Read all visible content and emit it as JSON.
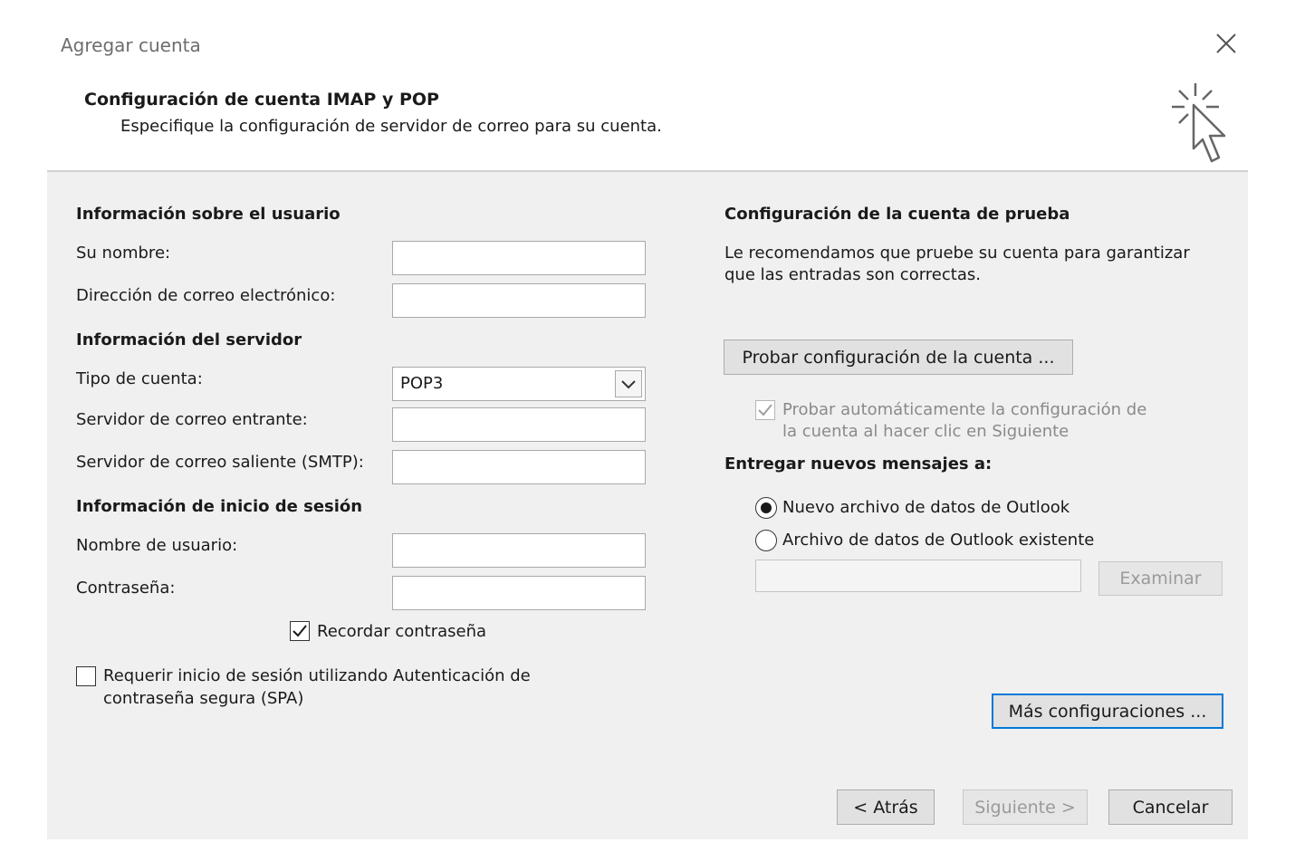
{
  "window": {
    "title": "Agregar cuenta",
    "close_icon": "close-icon"
  },
  "header": {
    "title": "Configuración de cuenta IMAP y POP",
    "subtitle": "Especifique la configuración de servidor de correo para su cuenta.",
    "icon": "wizard-cursor-icon"
  },
  "user_info": {
    "section_title": "Información sobre el usuario",
    "name_label": "Su nombre:",
    "name_value": "",
    "email_label": "Dirección de correo electrónico:",
    "email_value": ""
  },
  "server_info": {
    "section_title": "Información del servidor",
    "account_type_label": "Tipo de cuenta:",
    "account_type_value": "POP3",
    "incoming_label": "Servidor de correo entrante:",
    "incoming_value": "",
    "outgoing_label": "Servidor de correo saliente (SMTP):",
    "outgoing_value": ""
  },
  "login_info": {
    "section_title": "Información de inicio de sesión",
    "username_label": "Nombre de usuario:",
    "username_value": "",
    "password_label": "Contraseña:",
    "password_value": "",
    "remember_label": "Recordar contraseña",
    "remember_checked": true,
    "spa_label_line1": "Requerir inicio de sesión utilizando Autenticación de",
    "spa_label_line2": "contraseña segura (SPA)",
    "spa_checked": false
  },
  "test_settings": {
    "section_title": "Configuración de la cuenta de prueba",
    "desc_line1": "Le recomendamos que pruebe su cuenta para garantizar",
    "desc_line2": "que las entradas son correctas.",
    "test_button": "Probar configuración de la cuenta ...",
    "auto_test_line1": "Probar automáticamente la configuración de",
    "auto_test_line2": "la cuenta al hacer clic en Siguiente",
    "auto_test_checked": true
  },
  "deliver": {
    "section_title": "Entregar nuevos mensajes a:",
    "option_new": "Nuevo archivo de datos de Outlook",
    "option_existing": "Archivo de datos de Outlook existente",
    "selected": "option_new",
    "existing_path_value": "",
    "browse_button": "Examinar"
  },
  "more_settings_button": "Más configuraciones ...",
  "footer": {
    "back_button": "< Atrás",
    "next_button": "Siguiente >",
    "cancel_button": "Cancelar"
  },
  "colors": {
    "panel_bg": "#f0f0f0",
    "focus_border": "#0078d7",
    "disabled_text": "#9a9a9a"
  }
}
